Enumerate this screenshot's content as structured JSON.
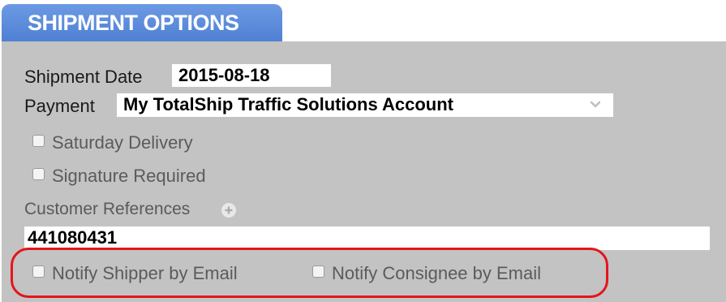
{
  "section": {
    "title": "SHIPMENT OPTIONS"
  },
  "shipment_date": {
    "label": "Shipment Date",
    "value": "2015-08-18"
  },
  "payment": {
    "label": "Payment",
    "selected": "My TotalShip Traffic Solutions Account"
  },
  "checkboxes": {
    "saturday_delivery": "Saturday Delivery",
    "signature_required": "Signature Required",
    "notify_shipper": "Notify Shipper by Email",
    "notify_consignee": "Notify Consignee by Email"
  },
  "customer_references": {
    "label": "Customer References",
    "value": "441080431"
  },
  "colors": {
    "tab_blue": "#5585d8",
    "panel_gray": "#c3c3c3",
    "highlight_red": "#e4151c"
  },
  "icons": {
    "payment_dropdown": "chevron-down-icon",
    "add_reference": "plus-circle-icon"
  }
}
